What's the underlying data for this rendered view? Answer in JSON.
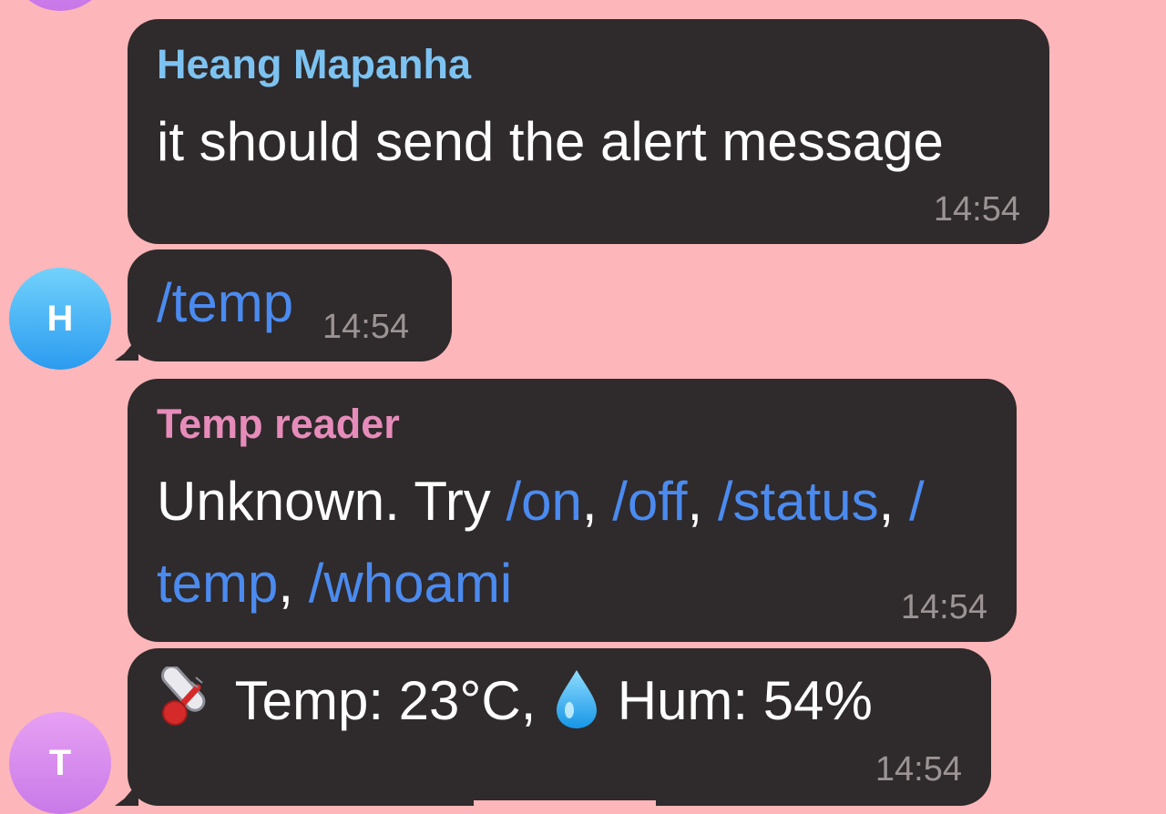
{
  "avatars": {
    "top": "",
    "heang": "H",
    "temp_reader": "T"
  },
  "messages": [
    {
      "sender": "Heang Mapanha",
      "text": "it should send the alert message",
      "time": "14:54"
    },
    {
      "text": "/temp",
      "time": "14:54"
    },
    {
      "sender": "Temp reader",
      "text_parts": [
        "Unknown. Try ",
        "/on",
        ", ",
        "/off",
        ", ",
        "/status",
        ", ",
        "/",
        "temp",
        ", ",
        "/whoami"
      ],
      "time": "14:54"
    },
    {
      "icons": [
        "thermometer-icon",
        "droplet-icon"
      ],
      "text_parts": [
        "Temp: 23°C,",
        "Hum: 54%"
      ],
      "time": "14:54"
    }
  ],
  "colors": {
    "background": "#fdb6b9",
    "bubble": "#2f2a2b",
    "heang_name": "#7cc3f2",
    "temp_reader_name": "#e78cba",
    "command_link": "#4b8bf0",
    "timestamp": "#9b9394"
  }
}
